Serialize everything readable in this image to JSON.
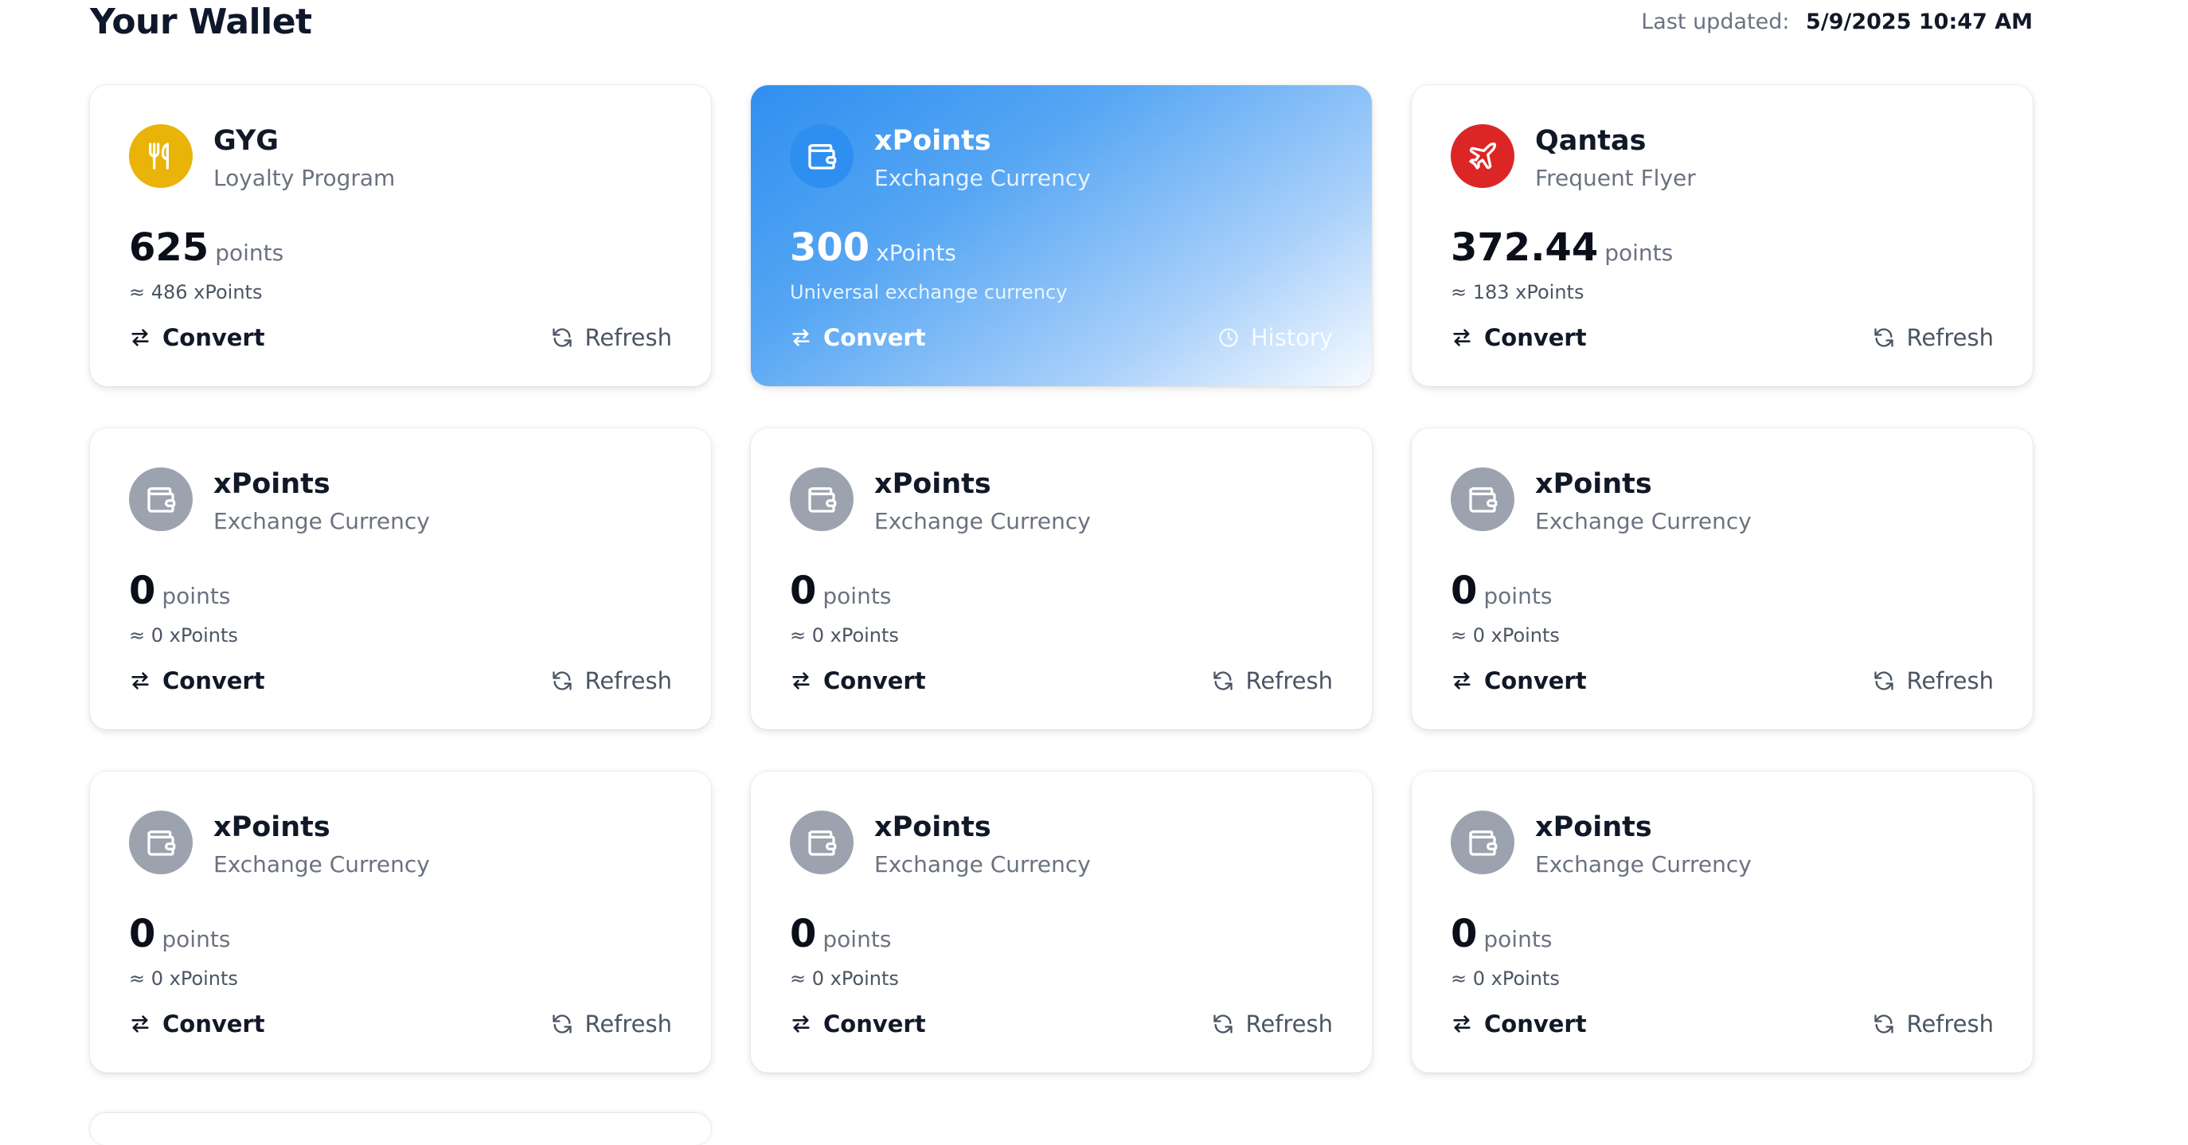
{
  "header": {
    "title": "Your Wallet",
    "last_updated_label": "Last updated:",
    "last_updated_value": "5/9/2025 10:47 AM"
  },
  "colors": {
    "gyg_icon": "#eab308",
    "xpoints_featured_icon": "#2f8ff0",
    "qantas_icon": "#dc2626",
    "inactive_icon": "#9ca3af",
    "featured_gradient_start": "#2f8ff0",
    "featured_gradient_end": "#f7fbff"
  },
  "cards": [
    {
      "name": "GYG",
      "subtitle": "Loyalty Program",
      "amount": "625",
      "unit": "points",
      "approx": "≈ 486 xPoints",
      "convert_label": "Convert",
      "secondary_label": "Refresh",
      "icon": "utensils-icon"
    },
    {
      "name": "xPoints",
      "subtitle": "Exchange Currency",
      "amount": "300",
      "unit": "xPoints",
      "approx": "Universal exchange currency",
      "convert_label": "Convert",
      "secondary_label": "History",
      "icon": "wallet-icon"
    },
    {
      "name": "Qantas",
      "subtitle": "Frequent Flyer",
      "amount": "372.44",
      "unit": "points",
      "approx": "≈ 183 xPoints",
      "convert_label": "Convert",
      "secondary_label": "Refresh",
      "icon": "plane-icon"
    },
    {
      "name": "xPoints",
      "subtitle": "Exchange Currency",
      "amount": "0",
      "unit": "points",
      "approx": "≈ 0 xPoints",
      "convert_label": "Convert",
      "secondary_label": "Refresh",
      "icon": "wallet-icon"
    },
    {
      "name": "xPoints",
      "subtitle": "Exchange Currency",
      "amount": "0",
      "unit": "points",
      "approx": "≈ 0 xPoints",
      "convert_label": "Convert",
      "secondary_label": "Refresh",
      "icon": "wallet-icon"
    },
    {
      "name": "xPoints",
      "subtitle": "Exchange Currency",
      "amount": "0",
      "unit": "points",
      "approx": "≈ 0 xPoints",
      "convert_label": "Convert",
      "secondary_label": "Refresh",
      "icon": "wallet-icon"
    },
    {
      "name": "xPoints",
      "subtitle": "Exchange Currency",
      "amount": "0",
      "unit": "points",
      "approx": "≈ 0 xPoints",
      "convert_label": "Convert",
      "secondary_label": "Refresh",
      "icon": "wallet-icon"
    },
    {
      "name": "xPoints",
      "subtitle": "Exchange Currency",
      "amount": "0",
      "unit": "points",
      "approx": "≈ 0 xPoints",
      "convert_label": "Convert",
      "secondary_label": "Refresh",
      "icon": "wallet-icon"
    },
    {
      "name": "xPoints",
      "subtitle": "Exchange Currency",
      "amount": "0",
      "unit": "points",
      "approx": "≈ 0 xPoints",
      "convert_label": "Convert",
      "secondary_label": "Refresh",
      "icon": "wallet-icon"
    }
  ]
}
